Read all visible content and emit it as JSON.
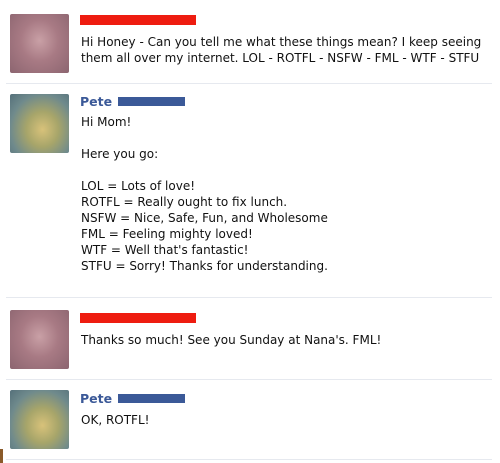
{
  "posts": [
    {
      "author": "",
      "message": "Hi Honey - Can you tell me what these things mean? I keep seeing them all over my internet. LOL - ROTFL - NSFW - FML - WTF - STFU"
    },
    {
      "author": "Pete",
      "message": "Hi Mom!\n\nHere you go:\n\nLOL = Lots of love!\nROTFL = Really ought to fix lunch.\nNSFW = Nice, Safe, Fun, and Wholesome\nFML = Feeling mighty loved!\nWTF = Well that's fantastic!\nSTFU = Sorry! Thanks for understanding."
    },
    {
      "author": "",
      "message": "Thanks so much! See you Sunday at Nana's. FML!"
    },
    {
      "author": "Pete",
      "message": "OK, ROTFL!"
    }
  ]
}
